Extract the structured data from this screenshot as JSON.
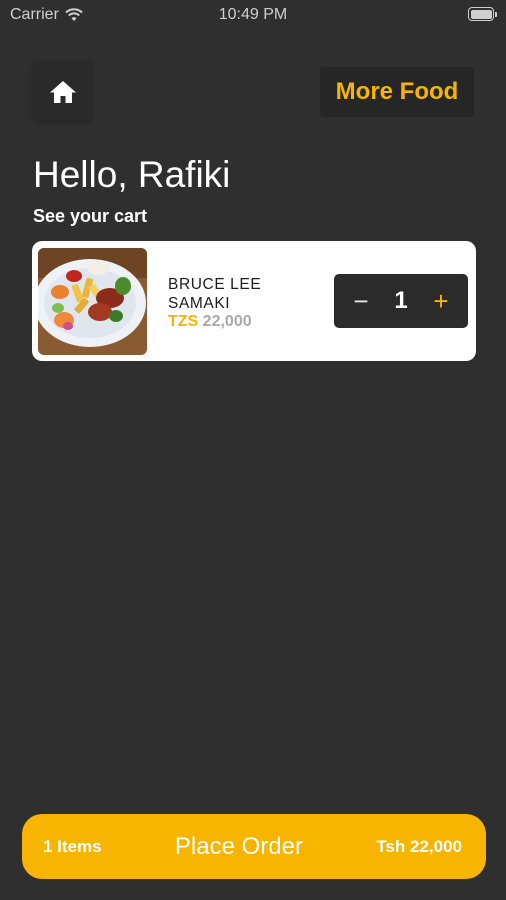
{
  "status_bar": {
    "carrier": "Carrier",
    "time": "10:49 PM"
  },
  "header": {
    "home_icon": "home-icon",
    "more_food_label": "More Food"
  },
  "greeting": {
    "title": "Hello, Rafiki",
    "subtitle": "See your cart"
  },
  "cart": {
    "items": [
      {
        "name": "BRUCE LEE SAMAKI",
        "currency": "TZS",
        "price": "22,000",
        "quantity": "1",
        "minus_label": "−",
        "plus_label": "+"
      }
    ]
  },
  "order_bar": {
    "count_label": "1 Items",
    "action_label": "Place Order",
    "total_label": "Tsh 22,000"
  },
  "colors": {
    "accent": "#f7b500",
    "background": "#2f2f2f",
    "card": "#ffffff"
  }
}
